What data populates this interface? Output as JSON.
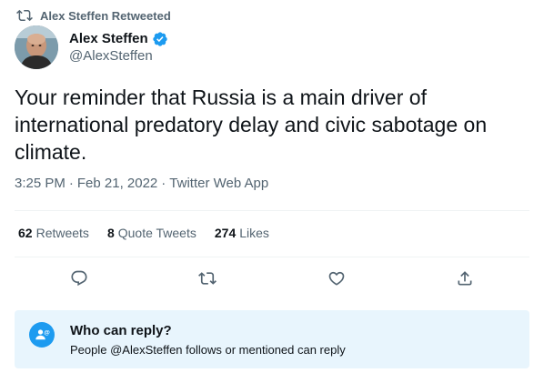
{
  "colors": {
    "accent": "#1d9bf0",
    "text": "#0f1419",
    "secondary": "#536471",
    "divider": "#eff3f4",
    "reply_bg": "#e8f5fd"
  },
  "retweet_context": {
    "icon": "retweet-icon",
    "label": "Alex Steffen Retweeted"
  },
  "author": {
    "display_name": "Alex Steffen",
    "handle": "@AlexSteffen",
    "verified_icon": "verified-badge-icon"
  },
  "tweet": {
    "text": "Your reminder that Russia is a main driver of international predatory delay and civic sabotage on climate.",
    "time": "3:25 PM",
    "separator1": "·",
    "date": "Feb 21, 2022",
    "separator2": "·",
    "source": "Twitter Web App"
  },
  "stats": {
    "retweets_count": "62",
    "retweets_label": "Retweets",
    "quotes_count": "8",
    "quotes_label": "Quote Tweets",
    "likes_count": "274",
    "likes_label": "Likes"
  },
  "actions": [
    {
      "icon": "reply-icon"
    },
    {
      "icon": "retweet-icon"
    },
    {
      "icon": "like-icon"
    },
    {
      "icon": "share-icon"
    }
  ],
  "who_can_reply": {
    "icon": "mention-person-icon",
    "title": "Who can reply?",
    "description": "People @AlexSteffen follows or mentioned can reply"
  }
}
